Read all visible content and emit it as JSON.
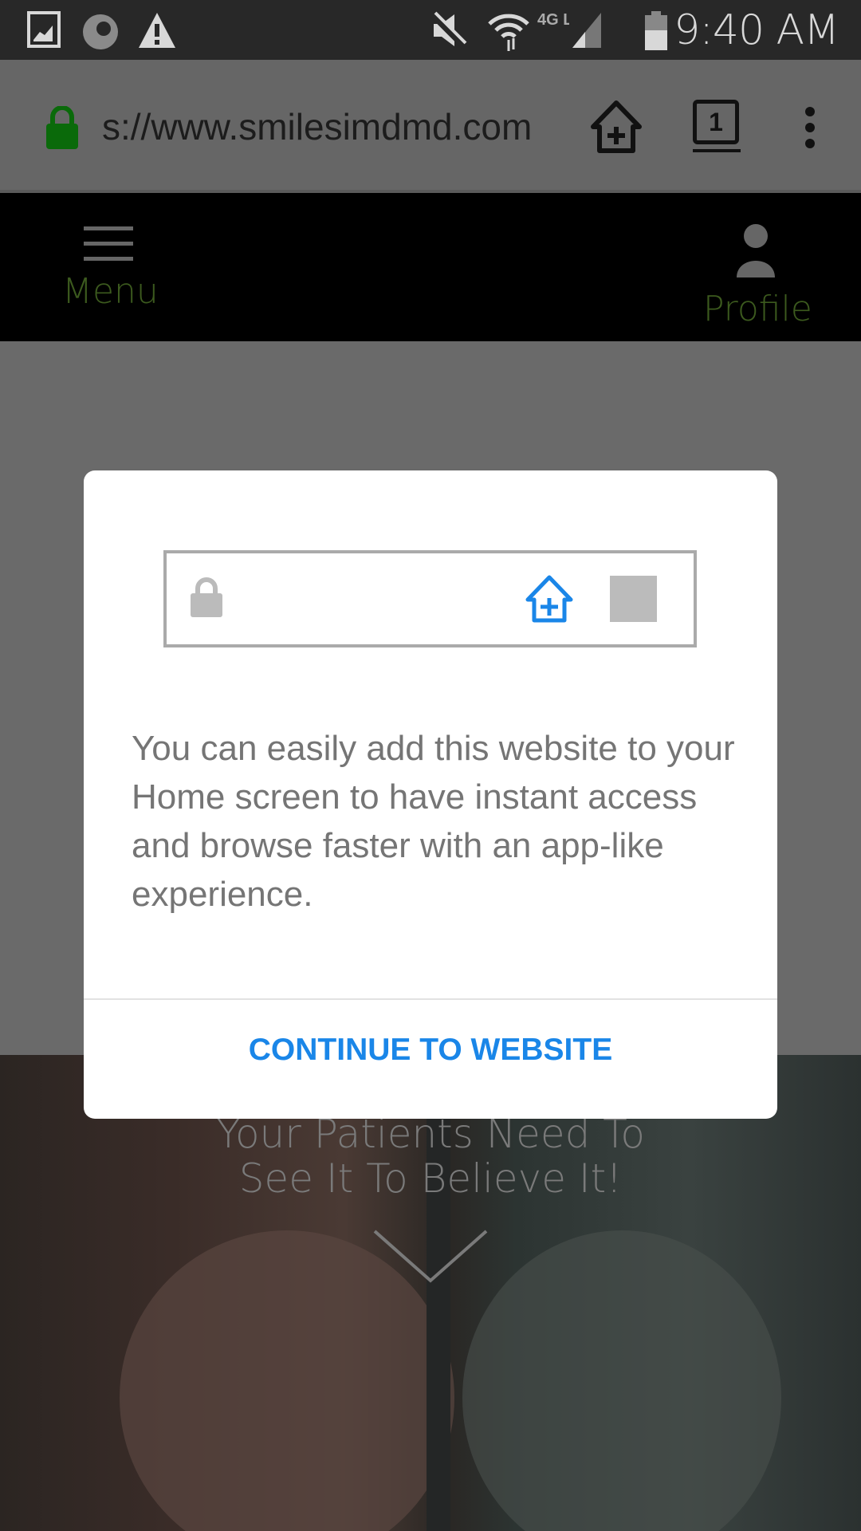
{
  "status_bar": {
    "time": "9:40 AM",
    "network": "4G LTE",
    "icons": [
      "gallery-icon",
      "firefox-icon",
      "warning-icon",
      "mute-icon",
      "wifi-icon",
      "signal-icon",
      "battery-icon"
    ]
  },
  "browser": {
    "url": "s://www.smilesimdmd.com",
    "tab_count": "1",
    "icons": [
      "lock-icon",
      "add-to-home-icon",
      "tabs-icon",
      "more-icon"
    ],
    "lock_color": "#0a6a0a"
  },
  "site_nav": {
    "menu_label": "Menu",
    "profile_label": "Profile",
    "label_color": "#3c5a1e"
  },
  "hero": {
    "line1": "Your Patients Need To",
    "line2": "See It To Believe It!"
  },
  "dialog": {
    "message": "You can easily add this website to your Home screen to have instant access and browse faster with an app-like experience.",
    "button_label": "CONTINUE TO WEBSITE",
    "accent": "#1a86e8"
  }
}
